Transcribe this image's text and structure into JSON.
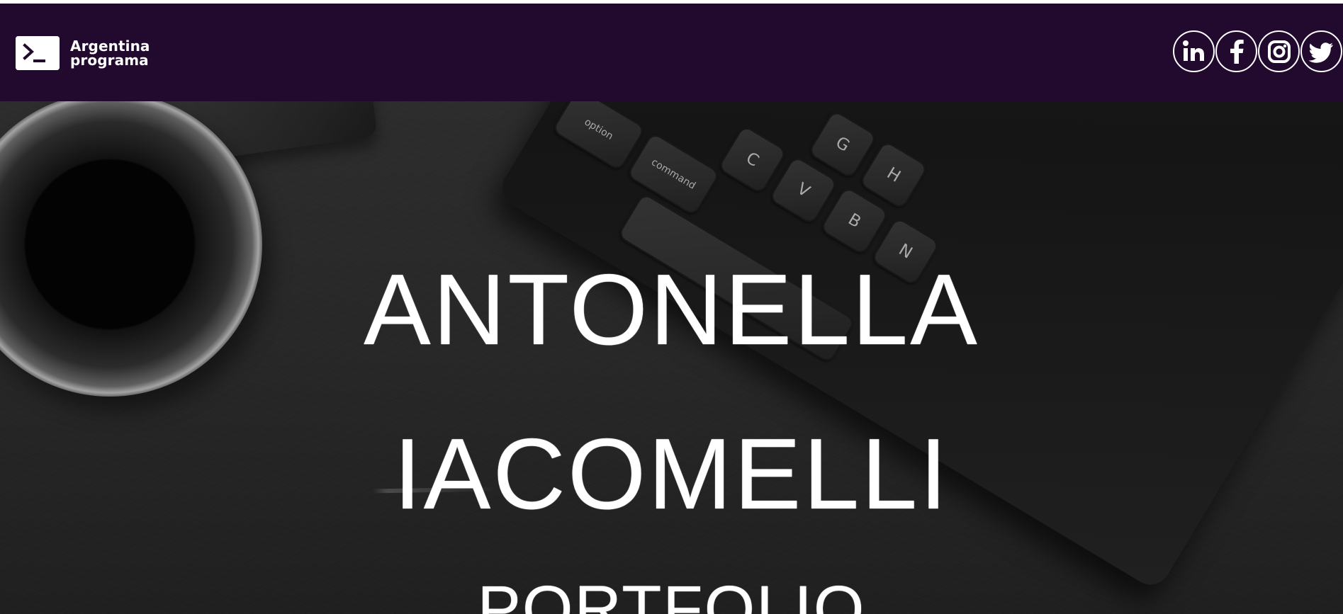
{
  "colors": {
    "navbar": "#220a2f",
    "hero_text": "#ffffff",
    "icon": "#ffffff"
  },
  "brand": {
    "line1": "Argentina",
    "line2": "programa",
    "icon": "terminal-prompt-icon"
  },
  "social_links": [
    {
      "name": "LinkedIn",
      "icon": "linkedin-icon"
    },
    {
      "name": "Facebook",
      "icon": "facebook-icon"
    },
    {
      "name": "Instagram",
      "icon": "instagram-icon"
    },
    {
      "name": "Twitter",
      "icon": "twitter-icon"
    }
  ],
  "hero": {
    "first_name": "ANTONELLA",
    "last_name": "IACOMELLI",
    "subtitle": "PORTFOLIO",
    "keyboard_keys": [
      {
        "label": "option",
        "small": true
      },
      {
        "label": "command",
        "small": true
      },
      {
        "label": "C"
      },
      {
        "label": "V"
      },
      {
        "label": "B"
      },
      {
        "label": "N"
      },
      {
        "label": "G"
      },
      {
        "label": "H"
      }
    ]
  }
}
